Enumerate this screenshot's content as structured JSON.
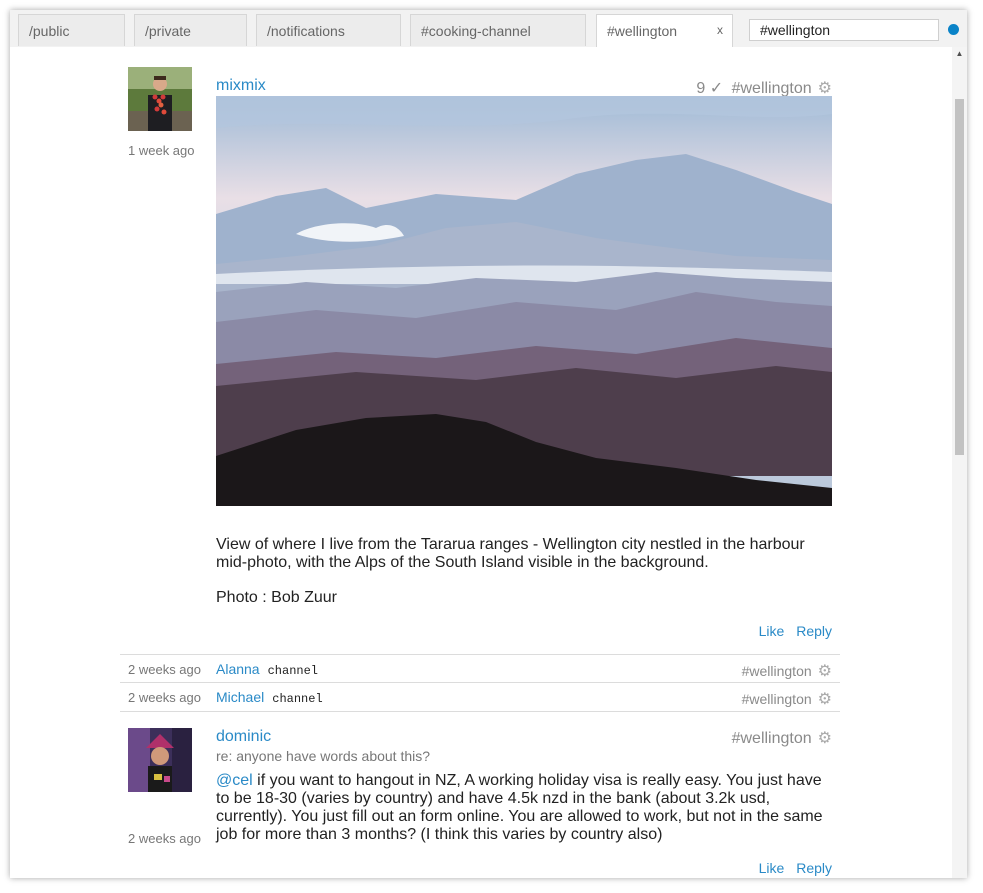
{
  "tabs": [
    {
      "label": "/public"
    },
    {
      "label": "/private"
    },
    {
      "label": "/notifications"
    },
    {
      "label": "#cooking-channel"
    },
    {
      "label": "#wellington",
      "active": true,
      "close": "x"
    }
  ],
  "search": {
    "value": "#wellington"
  },
  "colors": {
    "accent": "#2a8ac7",
    "status_dot": "#0a83c8"
  },
  "posts": [
    {
      "author": "mixmix",
      "time": "1 week ago",
      "votes": "9 ✓",
      "channel": "#wellington",
      "gear_icon": "gear-icon",
      "image_alt": "misty mountain ranges at dawn",
      "paragraphs": [
        "View of where I live from the Tararua ranges - Wellington city nestled in the harbour mid-photo, with the Alps of the South Island visible in the background.",
        "Photo : Bob Zuur"
      ],
      "actions": {
        "like": "Like",
        "reply": "Reply"
      }
    },
    {
      "author": "dominic",
      "time": "2 weeks ago",
      "channel": "#wellington",
      "gear_icon": "gear-icon",
      "subject": "re: anyone have words about this?",
      "mention": "@cel",
      "text": " if you want to hangout in NZ, A working holiday visa is really easy. You just have to be 18-30 (varies by country) and have 4.5k nzd in the bank (about 3.2k usd, currently). You just fill out an form online. You are allowed to work, but not in the same job for more than 3 months? (I think this varies by country also)",
      "actions": {
        "like": "Like",
        "reply": "Reply"
      }
    }
  ],
  "subscriptions": [
    {
      "time": "2 weeks ago",
      "name": "Alanna",
      "kind": "channel",
      "channel": "#wellington"
    },
    {
      "time": "2 weeks ago",
      "name": "Michael",
      "kind": "channel",
      "channel": "#wellington"
    }
  ]
}
